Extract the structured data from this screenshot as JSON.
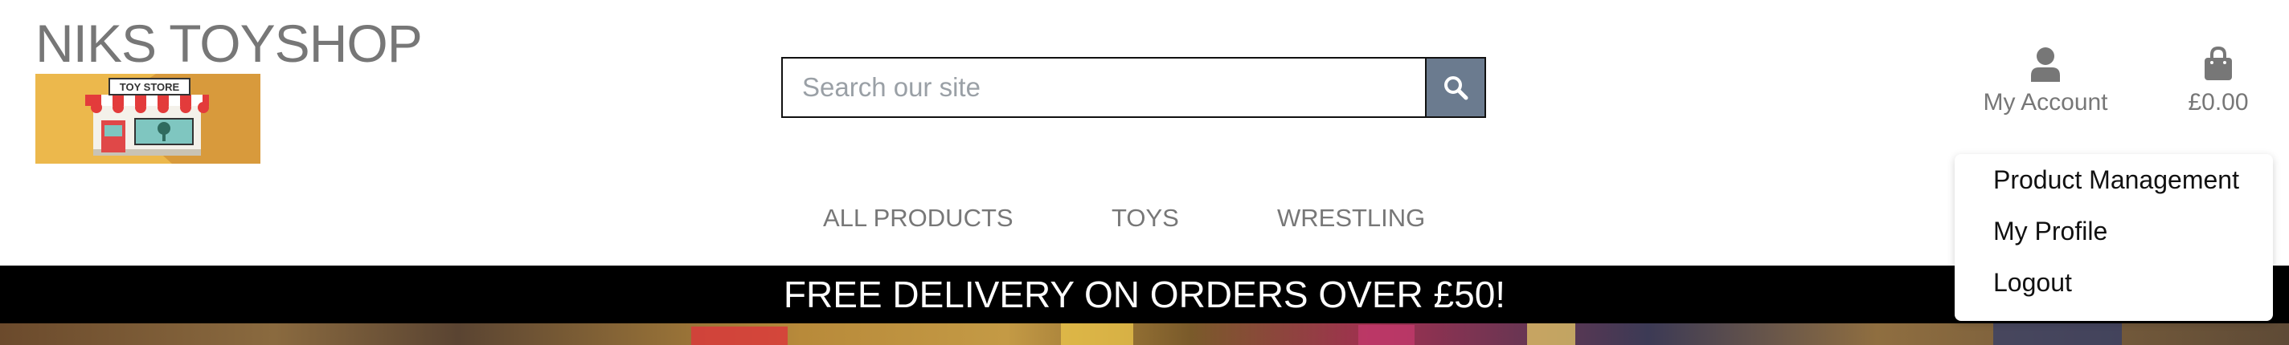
{
  "header": {
    "brand": "NIKS TOYSHOP",
    "logo_text": "TOY STORE"
  },
  "search": {
    "placeholder": "Search our site",
    "value": "",
    "button_icon": "search-icon"
  },
  "account": {
    "icon": "user-icon",
    "label": "My Account",
    "menu": [
      {
        "label": "Product Management"
      },
      {
        "label": "My Profile"
      },
      {
        "label": "Logout"
      }
    ]
  },
  "cart": {
    "icon": "shopping-bag-icon",
    "total": "£0.00"
  },
  "nav": {
    "items": [
      {
        "label": "ALL PRODUCTS"
      },
      {
        "label": "TOYS"
      },
      {
        "label": "WRESTLING"
      }
    ]
  },
  "banner": {
    "text": "FREE DELIVERY ON ORDERS OVER £50!"
  },
  "colors": {
    "brand_text": "#777777",
    "search_button": "#6b7b8f",
    "banner_bg": "#000000",
    "banner_text": "#ffffff",
    "logo_bg": "#ecb84c"
  }
}
